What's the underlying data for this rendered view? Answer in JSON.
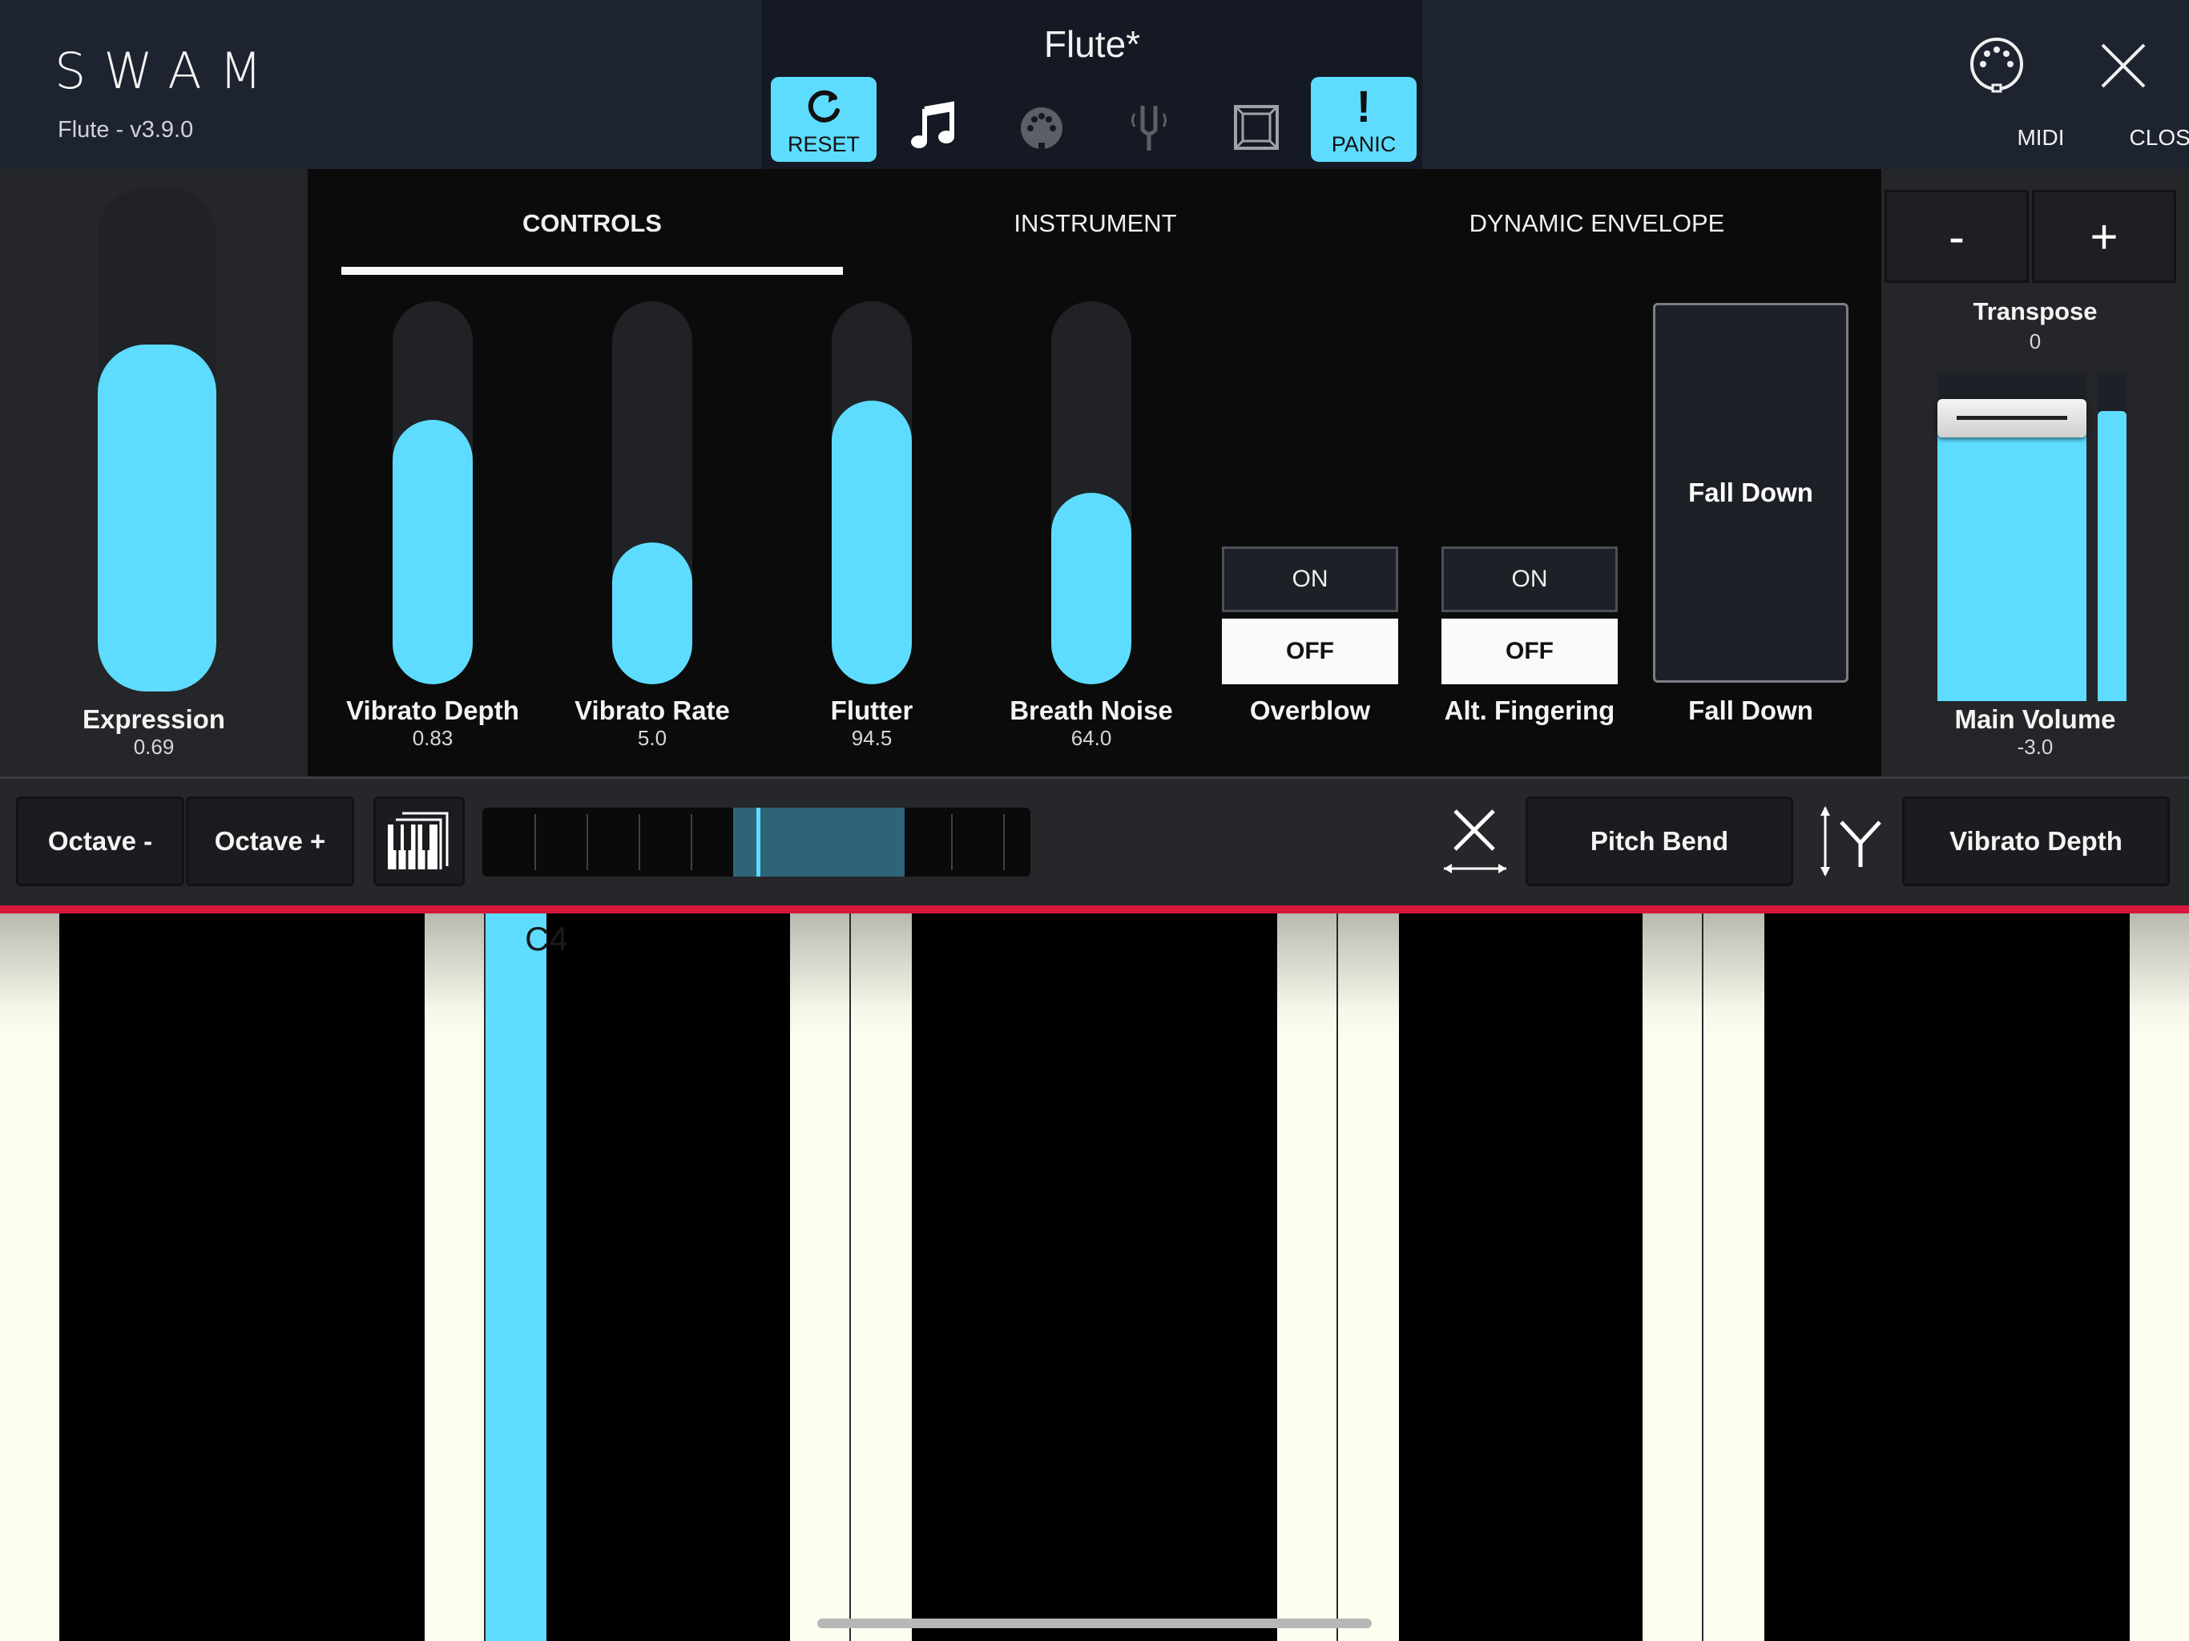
{
  "header": {
    "logo": "SWAM",
    "version": "Flute - v3.9.0",
    "preset_name": "Flute*",
    "toolbar": {
      "reset_label": "RESET",
      "panic_label": "PANIC",
      "panic_glyph": "!",
      "icons": [
        "refresh-icon",
        "music-note-icon",
        "midi-port-icon",
        "tuning-fork-icon",
        "window-frame-icon"
      ]
    },
    "midi_label": "MIDI",
    "close_label": "CLOSE"
  },
  "tabs": {
    "controls": "CONTROLS",
    "instrument": "INSTRUMENT",
    "dynamic_envelope": "DYNAMIC ENVELOPE",
    "active": "CONTROLS"
  },
  "expression": {
    "label": "Expression",
    "value": "0.69",
    "level": 0.69
  },
  "controls": [
    {
      "label": "Vibrato Depth",
      "value": "0.83",
      "level": 0.69
    },
    {
      "label": "Vibrato Rate",
      "value": "5.0",
      "level": 0.37
    },
    {
      "label": "Flutter",
      "value": "94.5",
      "level": 0.74
    },
    {
      "label": "Breath Noise",
      "value": "64.0",
      "level": 0.5
    }
  ],
  "switches": [
    {
      "label": "Overblow",
      "on": "ON",
      "off": "OFF",
      "state": "OFF"
    },
    {
      "label": "Alt. Fingering",
      "on": "ON",
      "off": "OFF",
      "state": "OFF"
    }
  ],
  "fall_down": {
    "button": "Fall Down",
    "label": "Fall Down"
  },
  "transpose": {
    "minus": "-",
    "plus": "+",
    "label": "Transpose",
    "value": "0"
  },
  "main_volume": {
    "label": "Main Volume",
    "value": "-3.0",
    "level": 0.86
  },
  "bottom_toolbar": {
    "octave_minus": "Octave -",
    "octave_plus": "Octave +",
    "x_axis_assign": "Pitch Bend",
    "y_axis_assign": "Vibrato Depth"
  },
  "keyboard": {
    "pressed_note": "C4"
  },
  "colors": {
    "accent": "#5edcff",
    "header_bg": "#1e2330",
    "key_line": "#d6173c"
  }
}
